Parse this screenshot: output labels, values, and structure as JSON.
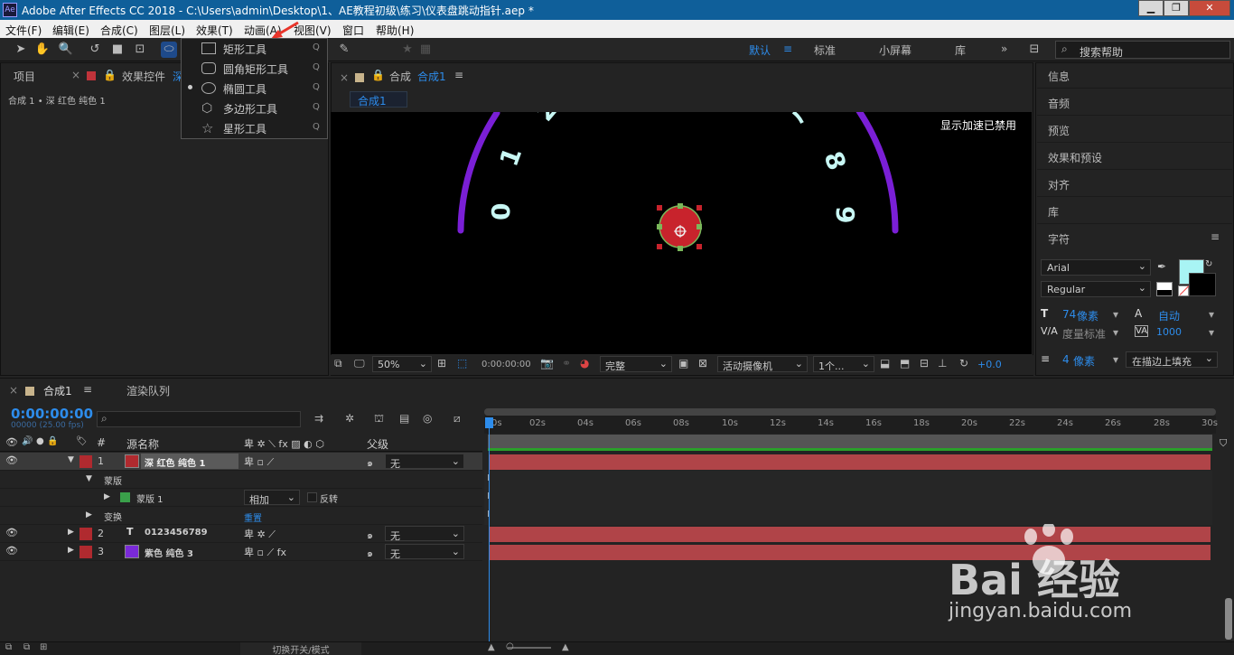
{
  "window": {
    "title": "Adobe After Effects CC 2018 - C:\\Users\\admin\\Desktop\\1、AE教程初级\\练习\\仪表盘跳动指针.aep *",
    "logo": "Ae"
  },
  "menu": [
    "文件(F)",
    "编辑(E)",
    "合成(C)",
    "图层(L)",
    "效果(T)",
    "动画(A)",
    "视图(V)",
    "窗口",
    "帮助(H)"
  ],
  "workspaces": {
    "default": "默认",
    "standard": "标准",
    "small": "小屏幕",
    "library": "库",
    "more": "»"
  },
  "help_search_placeholder": "搜索帮助",
  "shape_menu": [
    {
      "label": "矩形工具",
      "key": "Q",
      "icon": "rectangle-icon"
    },
    {
      "label": "圆角矩形工具",
      "key": "Q",
      "icon": "rounded-rect-icon"
    },
    {
      "label": "椭圆工具",
      "key": "Q",
      "icon": "ellipse-icon",
      "selected": true
    },
    {
      "label": "多边形工具",
      "key": "Q",
      "icon": "polygon-icon"
    },
    {
      "label": "星形工具",
      "key": "Q",
      "icon": "star-icon"
    }
  ],
  "project_panel": {
    "tab_project": "项目",
    "tab_effects": "效果控件",
    "tab_effects_more": "深",
    "subtitle": "合成 1 • 深 红色 纯色 1"
  },
  "comp_panel": {
    "tab": "合成",
    "tab_name": "合成1",
    "breadcrumb": "合成1",
    "gpu_notice": "显示加速已禁用",
    "dial_numbers": [
      "0",
      "1",
      "2",
      "8",
      "9"
    ],
    "zoom": "50%",
    "timecode": "0:00:00:00",
    "resolution": "完整",
    "camera": "活动摄像机",
    "views": "1个...",
    "exposure": "+0.0"
  },
  "right_panel": {
    "items": [
      "信息",
      "音频",
      "预览",
      "效果和预设",
      "对齐",
      "库"
    ],
    "character": {
      "title": "字符",
      "font": "Arial",
      "style": "Regular",
      "size_value": "74",
      "size_unit": "像素",
      "leading": "自动",
      "kerning": "度量标准",
      "tracking": "1000",
      "stroke_value": "4",
      "stroke_unit": "像素",
      "stroke_mode": "在描边上填充",
      "fill_color": "#a8f4f4"
    }
  },
  "timeline": {
    "tab_comp": "合成1",
    "tab_render": "渲染队列",
    "timecode": "0:00:00:00",
    "frame_info": "00000 (25.00 fps)",
    "columns": {
      "source_name": "源名称",
      "parent": "父级",
      "hash": "#"
    },
    "ruler": [
      "0s",
      "02s",
      "04s",
      "06s",
      "08s",
      "10s",
      "12s",
      "14s",
      "16s",
      "18s",
      "20s",
      "22s",
      "24s",
      "26s",
      "28s",
      "30s"
    ],
    "layers": [
      {
        "num": "1",
        "name": "深 红色 纯色 1",
        "color": "#b02a2f",
        "label_color": "#b02a2f",
        "parent": "无",
        "type": "solid"
      },
      {
        "num": "2",
        "name": "0123456789",
        "color": "#b02a2f",
        "label_color": "#b02a2f",
        "parent": "无",
        "type": "text"
      },
      {
        "num": "3",
        "name": "紫色 纯色 3",
        "color": "#7a2ad8",
        "label_color": "#b02a2f",
        "parent": "无",
        "type": "solid"
      }
    ],
    "mask_group": "蒙版",
    "mask_name": "蒙版 1",
    "mask_mode": "相加",
    "mask_invert": "反转",
    "transform": "变换",
    "reset": "重置",
    "footer": "切换开关/模式"
  },
  "watermark": {
    "brand": "Bai  经验",
    "url": "jingyan.baidu.com"
  },
  "colors": {
    "accent": "#2d8ceb",
    "titlebar": "#0f5f9a",
    "track": "#b04448",
    "dial_arc": "#7a1fd6",
    "dial_text": "#c8f7f4",
    "knob": "#c8232c"
  }
}
